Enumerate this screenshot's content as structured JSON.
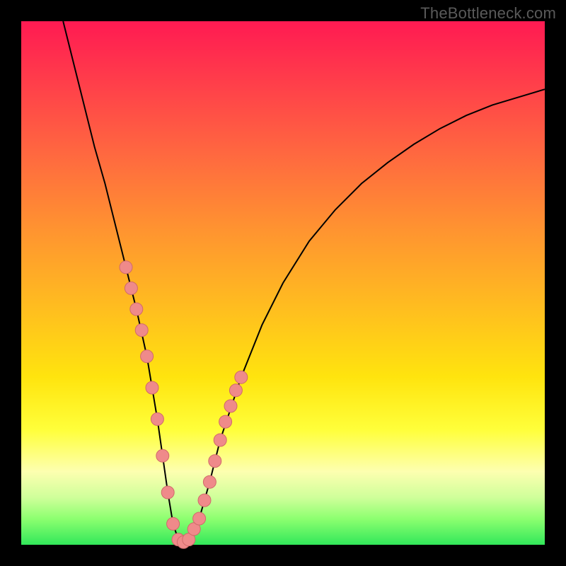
{
  "watermark": "TheBottleneck.com",
  "colors": {
    "frame": "#000000",
    "curve": "#000000",
    "dot_fill": "#ef8a8a",
    "dot_stroke": "#d06a6a"
  },
  "chart_data": {
    "type": "line",
    "title": "",
    "xlabel": "",
    "ylabel": "",
    "xlim": [
      0,
      100
    ],
    "ylim": [
      0,
      100
    ],
    "series": [
      {
        "name": "bottleneck-curve",
        "x": [
          8,
          10,
          12,
          14,
          16,
          18,
          20,
          22,
          24,
          26,
          27,
          28,
          29,
          30,
          31,
          32,
          34,
          36,
          38,
          42,
          46,
          50,
          55,
          60,
          65,
          70,
          75,
          80,
          85,
          90,
          95,
          100
        ],
        "y": [
          100,
          92,
          84,
          76,
          69,
          61,
          53,
          45,
          36,
          24,
          17,
          10,
          4,
          1,
          0.5,
          1,
          5,
          12,
          20,
          32,
          42,
          50,
          58,
          64,
          69,
          73,
          76.5,
          79.5,
          82,
          84,
          85.5,
          87
        ]
      }
    ],
    "scatter": {
      "name": "highlighted-points",
      "points": [
        {
          "x": 20.0,
          "y": 53
        },
        {
          "x": 21.0,
          "y": 49
        },
        {
          "x": 22.0,
          "y": 45
        },
        {
          "x": 23.0,
          "y": 41
        },
        {
          "x": 24.0,
          "y": 36
        },
        {
          "x": 25.0,
          "y": 30
        },
        {
          "x": 26.0,
          "y": 24
        },
        {
          "x": 27.0,
          "y": 17
        },
        {
          "x": 28.0,
          "y": 10
        },
        {
          "x": 29.0,
          "y": 4
        },
        {
          "x": 30.0,
          "y": 1
        },
        {
          "x": 31.0,
          "y": 0.5
        },
        {
          "x": 32.0,
          "y": 1
        },
        {
          "x": 33.0,
          "y": 3
        },
        {
          "x": 34.0,
          "y": 5
        },
        {
          "x": 35.0,
          "y": 8.5
        },
        {
          "x": 36.0,
          "y": 12
        },
        {
          "x": 37.0,
          "y": 16
        },
        {
          "x": 38.0,
          "y": 20
        },
        {
          "x": 39.0,
          "y": 23.5
        },
        {
          "x": 40.0,
          "y": 26.5
        },
        {
          "x": 41.0,
          "y": 29.5
        },
        {
          "x": 42.0,
          "y": 32
        }
      ]
    }
  }
}
